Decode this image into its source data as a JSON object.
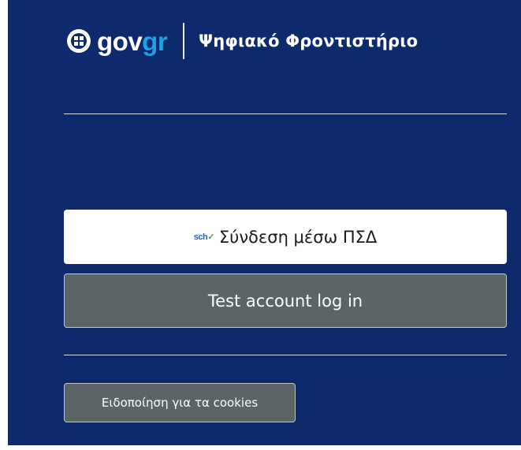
{
  "header": {
    "logo_gov": "gov",
    "logo_gr": "gr",
    "title": "Ψηφιακό Φροντιστήριο"
  },
  "login": {
    "sch_logo": "sch",
    "sch_label": "Σύνδεση μέσω ΠΣΔ",
    "test_label": "Test account log in"
  },
  "footer": {
    "cookies_label": "Ειδοποίηση για τα cookies"
  },
  "colors": {
    "panel_bg": "#0d2a6c",
    "gr_accent": "#1ea1e4",
    "button_gray": "#5b6566"
  }
}
